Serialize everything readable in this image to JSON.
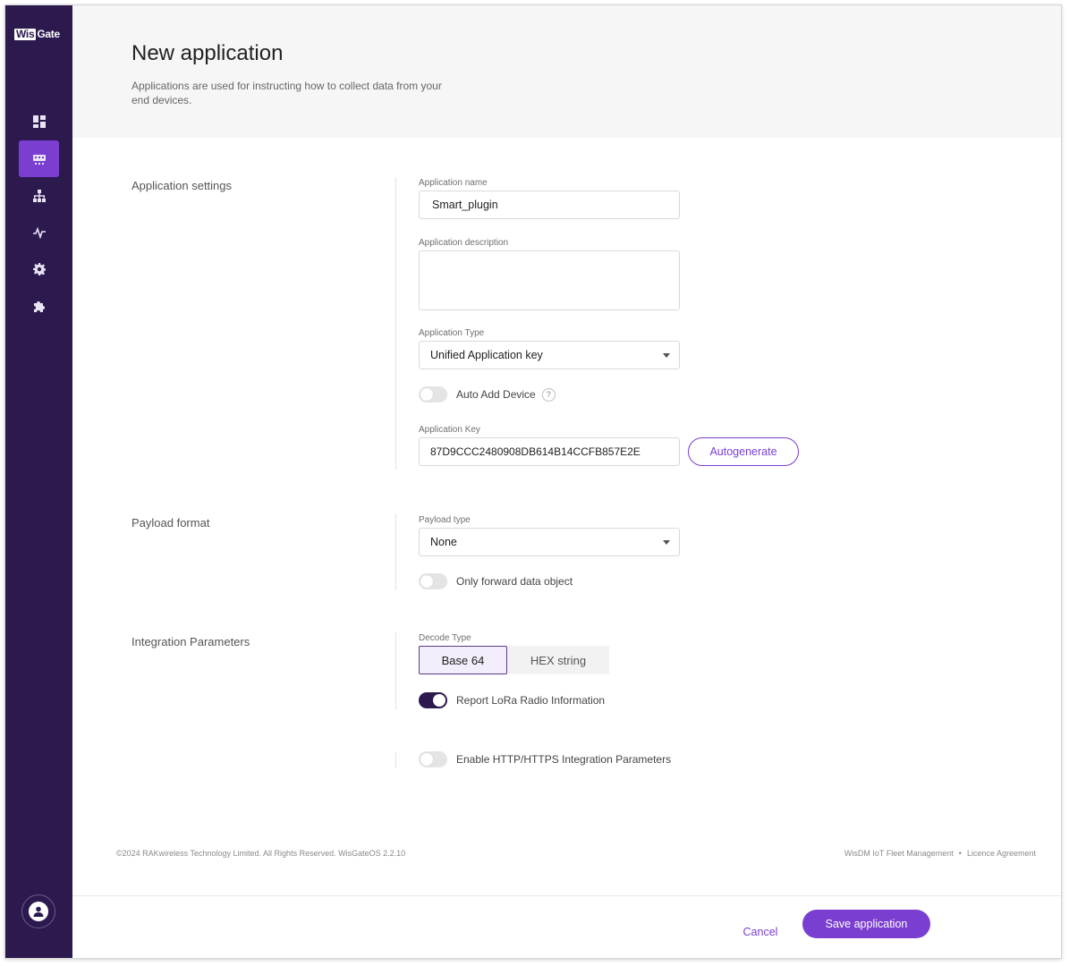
{
  "brand": {
    "logo_part1": "Wis",
    "logo_part2": "Gate",
    "accent": "#7a3fd0",
    "sidebar_bg": "#2c1a4f"
  },
  "nav": [
    {
      "icon": "dashboard-icon",
      "active": false
    },
    {
      "icon": "applications-icon",
      "active": true
    },
    {
      "icon": "network-icon",
      "active": false
    },
    {
      "icon": "activity-icon",
      "active": false
    },
    {
      "icon": "gear-icon",
      "active": false
    },
    {
      "icon": "puzzle-icon",
      "active": false
    }
  ],
  "header": {
    "title": "New application",
    "subtitle": "Applications are used for instructing how to collect data from your end devices."
  },
  "sections": {
    "app_settings": "Application settings",
    "payload_format": "Payload format",
    "integration": "Integration Parameters"
  },
  "form": {
    "app_name_label": "Application name",
    "app_name_value": "Smart_plugin",
    "app_description_label": "Application description",
    "app_description_value": "",
    "app_type_label": "Application Type",
    "app_type_value": "Unified Application key",
    "auto_add_label": "Auto Add Device",
    "auto_add_on": false,
    "help_glyph": "?",
    "app_key_label": "Application Key",
    "app_key_value": "87D9CCC2480908DB614B14CCFB857E2E",
    "autogenerate_label": "Autogenerate",
    "payload_type_label": "Payload type",
    "payload_type_value": "None",
    "only_forward_label": "Only forward data object",
    "only_forward_on": false,
    "decode_type_label": "Decode Type",
    "decode_options": [
      "Base 64",
      "HEX string"
    ],
    "decode_selected": "Base 64",
    "report_lora_label": "Report LoRa Radio Information",
    "report_lora_on": true,
    "enable_http_label": "Enable HTTP/HTTPS Integration Parameters",
    "enable_http_on": false
  },
  "footer": {
    "copyright": "©2024 RAKwireless Technology Limited. All Rights Reserved. WisGateOS 2.2.10",
    "link_fleet": "WisDM IoT Fleet Management",
    "separator": "•",
    "link_licence": "Licence Agreement"
  },
  "actions": {
    "cancel": "Cancel",
    "save": "Save application"
  }
}
